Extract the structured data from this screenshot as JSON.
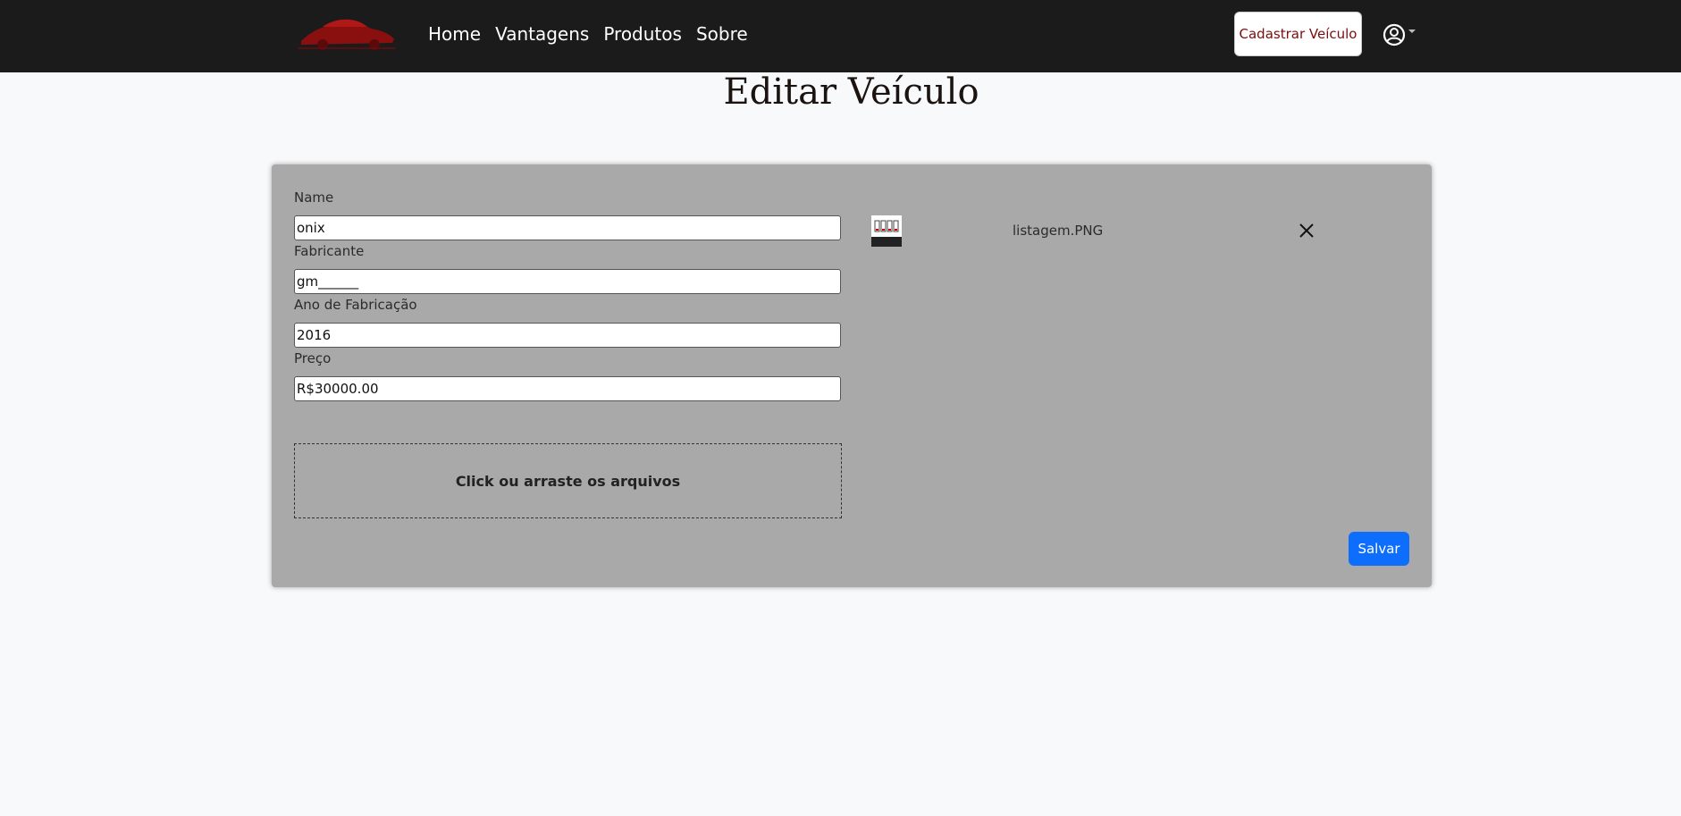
{
  "navbar": {
    "logo_icon": "car-logo-icon",
    "links": [
      "Home",
      "Vantagens",
      "Produtos",
      "Sobre"
    ],
    "cta_label": "Cadastrar Veículo",
    "user_icon": "user-circle-icon",
    "accent_color": "#7a0d0d"
  },
  "page": {
    "title": "Editar Veículo"
  },
  "form": {
    "fields": [
      {
        "label": "Name",
        "value": "onix"
      },
      {
        "label": "Fabricante",
        "value": "gm______"
      },
      {
        "label": "Ano de Fabricação",
        "value": "2016"
      },
      {
        "label": "Preço",
        "value": "R$30000.00"
      }
    ],
    "dropzone_label": "Click ou arraste os arquivos",
    "save_label": "Salvar",
    "save_color": "#0d6efd"
  },
  "files": [
    {
      "name": "listagem.PNG",
      "remove_icon": "close-icon"
    }
  ]
}
